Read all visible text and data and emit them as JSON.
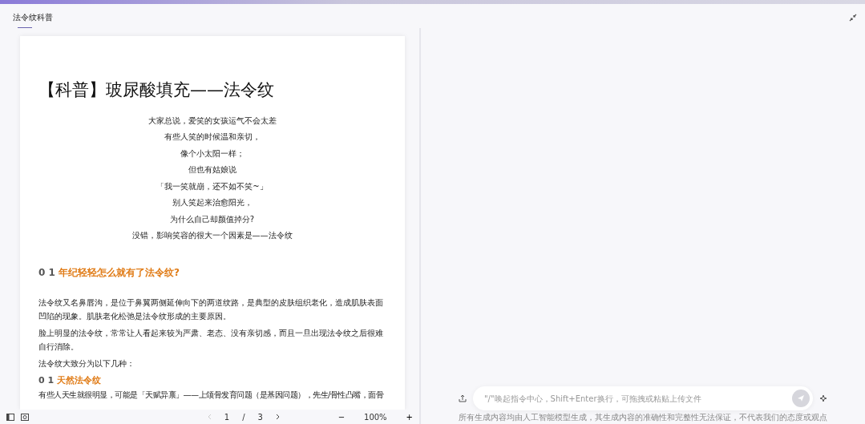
{
  "tabs": [
    {
      "label": "法令纹科普",
      "selected": true
    }
  ],
  "document": {
    "title": "【科普】玻尿酸填充——法令纹",
    "poem": [
      "大家总说，爱笑的女孩运气不会太差",
      "有些人笑的时候温和亲切，",
      "像个小太阳一样；",
      "但也有姑娘说",
      "「我一笑就崩，还不如不笑~」",
      "别人笑起来治愈阳光，",
      "为什么自己却颜值掉分?",
      "没错，影响笑容的很大一个因素是——法令纹"
    ],
    "blocks": [
      {
        "kind": "heading",
        "number": "0 1",
        "text": "年纪轻轻怎么就有了法令纹?"
      },
      {
        "kind": "paragraph",
        "text": "法令纹又名鼻唇沟，是位于鼻翼两侧延伸向下的两道纹路，是典型的皮肤组织老化，造成肌肤表面凹陷的现象。肌肤老化松弛是法令纹形成的主要原因。"
      },
      {
        "kind": "paragraph",
        "text": "脸上明显的法令纹，常常让人看起来较为严肃、老态、没有亲切感，而且一旦出现法令纹之后很难自行消除。"
      },
      {
        "kind": "paragraph",
        "text": "法令纹大致分为以下几种："
      },
      {
        "kind": "subheading",
        "number": "0 1",
        "text": "天然法令纹"
      },
      {
        "kind": "paragraph",
        "text": "有些人天生就很明显，可能是「天赋异禀」——上颌骨发育问题（是基因问题），先生/骨性凸嘴，面骨"
      }
    ]
  },
  "pager": {
    "page": "1",
    "separator": "/",
    "total": "3",
    "zoom": "100%",
    "zoom_out": "−",
    "zoom_in": "+"
  },
  "chat": {
    "placeholder": "\"/\"唤起指令中心，Shift+Enter换行，可拖拽或粘贴上传文件",
    "disclaimer": "所有生成内容均由人工智能模型生成，其生成内容的准确性和完整性无法保证，不代表我们的态度或观点"
  }
}
